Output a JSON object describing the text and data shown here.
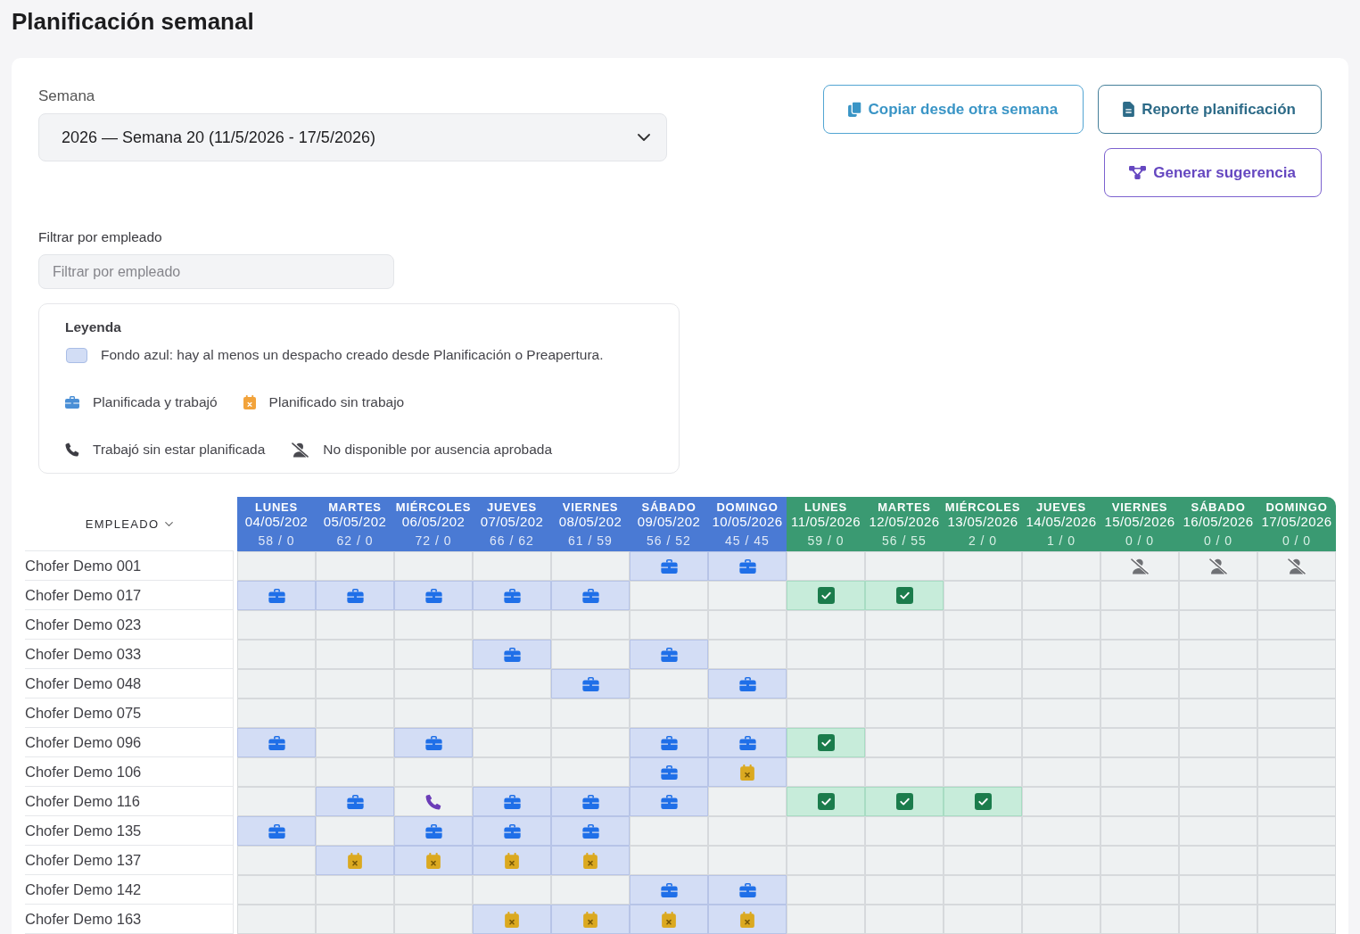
{
  "title": "Planificación semanal",
  "week_select": {
    "label": "Semana",
    "value": "2026 — Semana 20 (11/5/2026 - 17/5/2026)"
  },
  "actions": [
    {
      "kind": "copy",
      "label": "Copiar desde otra semana"
    },
    {
      "kind": "report",
      "label": "Reporte planificación"
    },
    {
      "kind": "suggest",
      "label": "Generar sugerencia"
    }
  ],
  "employee_filter": {
    "label": "Filtrar por empleado",
    "placeholder": "Filtrar por empleado"
  },
  "legend": {
    "title": "Leyenda",
    "rows": [
      [
        {
          "kind": "dispatch",
          "text": "Fondo azul: hay al menos un despacho creado desde Planificación o Preapertura."
        }
      ],
      [
        {
          "kind": "worked",
          "text": "Planificada y trabajó"
        },
        {
          "kind": "planned_no_work",
          "text": "Planificado sin trabajo"
        }
      ],
      [
        {
          "kind": "worked_unplanned",
          "text": "Trabajó sin estar planificada"
        },
        {
          "kind": "absent",
          "text": "No disponible por ausencia aprobada"
        }
      ]
    ]
  },
  "schedule": {
    "employee_column": "EMPLEADO",
    "weeks": [
      {
        "current": false,
        "days": [
          {
            "day": "LUNES",
            "date": "04/05/202",
            "counts": "58 / 0"
          },
          {
            "day": "MARTES",
            "date": "05/05/202",
            "counts": "62 / 0"
          },
          {
            "day": "MIÉRCOLES",
            "date": "06/05/202",
            "counts": "72 / 0"
          },
          {
            "day": "JUEVES",
            "date": "07/05/202",
            "counts": "66 / 62"
          },
          {
            "day": "VIERNES",
            "date": "08/05/202",
            "counts": "61 / 59"
          },
          {
            "day": "SÁBADO",
            "date": "09/05/202",
            "counts": "56 / 52"
          },
          {
            "day": "DOMINGO",
            "date": "10/05/2026",
            "counts": "45 / 45"
          }
        ]
      },
      {
        "current": true,
        "days": [
          {
            "day": "LUNES",
            "date": "11/05/2026",
            "counts": "59 / 0"
          },
          {
            "day": "MARTES",
            "date": "12/05/2026",
            "counts": "56 / 55"
          },
          {
            "day": "MIÉRCOLES",
            "date": "13/05/2026",
            "counts": "2 / 0"
          },
          {
            "day": "JUEVES",
            "date": "14/05/2026",
            "counts": "1 / 0"
          },
          {
            "day": "VIERNES",
            "date": "15/05/2026",
            "counts": "0 / 0"
          },
          {
            "day": "SÁBADO",
            "date": "16/05/2026",
            "counts": "0 / 0"
          },
          {
            "day": "DOMINGO",
            "date": "17/05/2026",
            "counts": "0 / 0"
          }
        ]
      }
    ],
    "rows": [
      {
        "employee": "Chofer Demo 001",
        "cells": [
          {
            "kind": "empty",
            "dispatch": false
          },
          {
            "kind": "empty",
            "dispatch": false
          },
          {
            "kind": "empty",
            "dispatch": false
          },
          {
            "kind": "empty",
            "dispatch": false
          },
          {
            "kind": "empty",
            "dispatch": false
          },
          {
            "kind": "worked",
            "dispatch": true
          },
          {
            "kind": "worked",
            "dispatch": true
          },
          {
            "kind": "empty",
            "dispatch": false
          },
          {
            "kind": "empty",
            "dispatch": false
          },
          {
            "kind": "empty",
            "dispatch": false
          },
          {
            "kind": "empty",
            "dispatch": false
          },
          {
            "kind": "absent",
            "dispatch": false
          },
          {
            "kind": "absent",
            "dispatch": false
          },
          {
            "kind": "absent",
            "dispatch": false
          }
        ]
      },
      {
        "employee": "Chofer Demo 017",
        "cells": [
          {
            "kind": "worked",
            "dispatch": true
          },
          {
            "kind": "worked",
            "dispatch": true
          },
          {
            "kind": "worked",
            "dispatch": true
          },
          {
            "kind": "worked",
            "dispatch": true
          },
          {
            "kind": "worked",
            "dispatch": true
          },
          {
            "kind": "empty",
            "dispatch": false
          },
          {
            "kind": "empty",
            "dispatch": false
          },
          {
            "kind": "confirmed",
            "dispatch": false
          },
          {
            "kind": "confirmed",
            "dispatch": false
          },
          {
            "kind": "empty",
            "dispatch": false
          },
          {
            "kind": "empty",
            "dispatch": false
          },
          {
            "kind": "empty",
            "dispatch": false
          },
          {
            "kind": "empty",
            "dispatch": false
          },
          {
            "kind": "empty",
            "dispatch": false
          }
        ]
      },
      {
        "employee": "Chofer Demo 023",
        "cells": [
          {
            "kind": "empty",
            "dispatch": false
          },
          {
            "kind": "empty",
            "dispatch": false
          },
          {
            "kind": "empty",
            "dispatch": false
          },
          {
            "kind": "empty",
            "dispatch": false
          },
          {
            "kind": "empty",
            "dispatch": false
          },
          {
            "kind": "empty",
            "dispatch": false
          },
          {
            "kind": "empty",
            "dispatch": false
          },
          {
            "kind": "empty",
            "dispatch": false
          },
          {
            "kind": "empty",
            "dispatch": false
          },
          {
            "kind": "empty",
            "dispatch": false
          },
          {
            "kind": "empty",
            "dispatch": false
          },
          {
            "kind": "empty",
            "dispatch": false
          },
          {
            "kind": "empty",
            "dispatch": false
          },
          {
            "kind": "empty",
            "dispatch": false
          }
        ]
      },
      {
        "employee": "Chofer Demo 033",
        "cells": [
          {
            "kind": "empty",
            "dispatch": false
          },
          {
            "kind": "empty",
            "dispatch": false
          },
          {
            "kind": "empty",
            "dispatch": false
          },
          {
            "kind": "worked",
            "dispatch": true
          },
          {
            "kind": "empty",
            "dispatch": false
          },
          {
            "kind": "worked",
            "dispatch": true
          },
          {
            "kind": "empty",
            "dispatch": false
          },
          {
            "kind": "empty",
            "dispatch": false
          },
          {
            "kind": "empty",
            "dispatch": false
          },
          {
            "kind": "empty",
            "dispatch": false
          },
          {
            "kind": "empty",
            "dispatch": false
          },
          {
            "kind": "empty",
            "dispatch": false
          },
          {
            "kind": "empty",
            "dispatch": false
          },
          {
            "kind": "empty",
            "dispatch": false
          }
        ]
      },
      {
        "employee": "Chofer Demo 048",
        "cells": [
          {
            "kind": "empty",
            "dispatch": false
          },
          {
            "kind": "empty",
            "dispatch": false
          },
          {
            "kind": "empty",
            "dispatch": false
          },
          {
            "kind": "empty",
            "dispatch": false
          },
          {
            "kind": "worked",
            "dispatch": true
          },
          {
            "kind": "empty",
            "dispatch": false
          },
          {
            "kind": "worked",
            "dispatch": true
          },
          {
            "kind": "empty",
            "dispatch": false
          },
          {
            "kind": "empty",
            "dispatch": false
          },
          {
            "kind": "empty",
            "dispatch": false
          },
          {
            "kind": "empty",
            "dispatch": false
          },
          {
            "kind": "empty",
            "dispatch": false
          },
          {
            "kind": "empty",
            "dispatch": false
          },
          {
            "kind": "empty",
            "dispatch": false
          }
        ]
      },
      {
        "employee": "Chofer Demo 075",
        "cells": [
          {
            "kind": "empty",
            "dispatch": false
          },
          {
            "kind": "empty",
            "dispatch": false
          },
          {
            "kind": "empty",
            "dispatch": false
          },
          {
            "kind": "empty",
            "dispatch": false
          },
          {
            "kind": "empty",
            "dispatch": false
          },
          {
            "kind": "empty",
            "dispatch": false
          },
          {
            "kind": "empty",
            "dispatch": false
          },
          {
            "kind": "empty",
            "dispatch": false
          },
          {
            "kind": "empty",
            "dispatch": false
          },
          {
            "kind": "empty",
            "dispatch": false
          },
          {
            "kind": "empty",
            "dispatch": false
          },
          {
            "kind": "empty",
            "dispatch": false
          },
          {
            "kind": "empty",
            "dispatch": false
          },
          {
            "kind": "empty",
            "dispatch": false
          }
        ]
      },
      {
        "employee": "Chofer Demo 096",
        "cells": [
          {
            "kind": "worked",
            "dispatch": true
          },
          {
            "kind": "empty",
            "dispatch": false
          },
          {
            "kind": "worked",
            "dispatch": true
          },
          {
            "kind": "empty",
            "dispatch": false
          },
          {
            "kind": "empty",
            "dispatch": false
          },
          {
            "kind": "worked",
            "dispatch": true
          },
          {
            "kind": "worked",
            "dispatch": true
          },
          {
            "kind": "confirmed",
            "dispatch": false
          },
          {
            "kind": "empty",
            "dispatch": false
          },
          {
            "kind": "empty",
            "dispatch": false
          },
          {
            "kind": "empty",
            "dispatch": false
          },
          {
            "kind": "empty",
            "dispatch": false
          },
          {
            "kind": "empty",
            "dispatch": false
          },
          {
            "kind": "empty",
            "dispatch": false
          }
        ]
      },
      {
        "employee": "Chofer Demo 106",
        "cells": [
          {
            "kind": "empty",
            "dispatch": false
          },
          {
            "kind": "empty",
            "dispatch": false
          },
          {
            "kind": "empty",
            "dispatch": false
          },
          {
            "kind": "empty",
            "dispatch": false
          },
          {
            "kind": "empty",
            "dispatch": false
          },
          {
            "kind": "worked",
            "dispatch": true
          },
          {
            "kind": "planned_no_work",
            "dispatch": true
          },
          {
            "kind": "empty",
            "dispatch": false
          },
          {
            "kind": "empty",
            "dispatch": false
          },
          {
            "kind": "empty",
            "dispatch": false
          },
          {
            "kind": "empty",
            "dispatch": false
          },
          {
            "kind": "empty",
            "dispatch": false
          },
          {
            "kind": "empty",
            "dispatch": false
          },
          {
            "kind": "empty",
            "dispatch": false
          }
        ]
      },
      {
        "employee": "Chofer Demo 116",
        "cells": [
          {
            "kind": "empty",
            "dispatch": false
          },
          {
            "kind": "worked",
            "dispatch": true
          },
          {
            "kind": "worked_unplanned",
            "dispatch": false
          },
          {
            "kind": "worked",
            "dispatch": true
          },
          {
            "kind": "worked",
            "dispatch": true
          },
          {
            "kind": "worked",
            "dispatch": true
          },
          {
            "kind": "empty",
            "dispatch": false
          },
          {
            "kind": "confirmed",
            "dispatch": false
          },
          {
            "kind": "confirmed",
            "dispatch": false
          },
          {
            "kind": "confirmed",
            "dispatch": false
          },
          {
            "kind": "empty",
            "dispatch": false
          },
          {
            "kind": "empty",
            "dispatch": false
          },
          {
            "kind": "empty",
            "dispatch": false
          },
          {
            "kind": "empty",
            "dispatch": false
          }
        ]
      },
      {
        "employee": "Chofer Demo 135",
        "cells": [
          {
            "kind": "worked",
            "dispatch": true
          },
          {
            "kind": "empty",
            "dispatch": false
          },
          {
            "kind": "worked",
            "dispatch": true
          },
          {
            "kind": "worked",
            "dispatch": true
          },
          {
            "kind": "worked",
            "dispatch": true
          },
          {
            "kind": "empty",
            "dispatch": false
          },
          {
            "kind": "empty",
            "dispatch": false
          },
          {
            "kind": "empty",
            "dispatch": false
          },
          {
            "kind": "empty",
            "dispatch": false
          },
          {
            "kind": "empty",
            "dispatch": false
          },
          {
            "kind": "empty",
            "dispatch": false
          },
          {
            "kind": "empty",
            "dispatch": false
          },
          {
            "kind": "empty",
            "dispatch": false
          },
          {
            "kind": "empty",
            "dispatch": false
          }
        ]
      },
      {
        "employee": "Chofer Demo 137",
        "cells": [
          {
            "kind": "empty",
            "dispatch": false
          },
          {
            "kind": "planned_no_work",
            "dispatch": true
          },
          {
            "kind": "planned_no_work",
            "dispatch": true
          },
          {
            "kind": "planned_no_work",
            "dispatch": true
          },
          {
            "kind": "planned_no_work",
            "dispatch": true
          },
          {
            "kind": "empty",
            "dispatch": false
          },
          {
            "kind": "empty",
            "dispatch": false
          },
          {
            "kind": "empty",
            "dispatch": false
          },
          {
            "kind": "empty",
            "dispatch": false
          },
          {
            "kind": "empty",
            "dispatch": false
          },
          {
            "kind": "empty",
            "dispatch": false
          },
          {
            "kind": "empty",
            "dispatch": false
          },
          {
            "kind": "empty",
            "dispatch": false
          },
          {
            "kind": "empty",
            "dispatch": false
          }
        ]
      },
      {
        "employee": "Chofer Demo 142",
        "cells": [
          {
            "kind": "empty",
            "dispatch": false
          },
          {
            "kind": "empty",
            "dispatch": false
          },
          {
            "kind": "empty",
            "dispatch": false
          },
          {
            "kind": "empty",
            "dispatch": false
          },
          {
            "kind": "empty",
            "dispatch": false
          },
          {
            "kind": "worked",
            "dispatch": true
          },
          {
            "kind": "worked",
            "dispatch": true
          },
          {
            "kind": "empty",
            "dispatch": false
          },
          {
            "kind": "empty",
            "dispatch": false
          },
          {
            "kind": "empty",
            "dispatch": false
          },
          {
            "kind": "empty",
            "dispatch": false
          },
          {
            "kind": "empty",
            "dispatch": false
          },
          {
            "kind": "empty",
            "dispatch": false
          },
          {
            "kind": "empty",
            "dispatch": false
          }
        ]
      },
      {
        "employee": "Chofer Demo 163",
        "cells": [
          {
            "kind": "empty",
            "dispatch": false
          },
          {
            "kind": "empty",
            "dispatch": false
          },
          {
            "kind": "empty",
            "dispatch": false
          },
          {
            "kind": "planned_no_work",
            "dispatch": true
          },
          {
            "kind": "planned_no_work",
            "dispatch": true
          },
          {
            "kind": "planned_no_work",
            "dispatch": true
          },
          {
            "kind": "planned_no_work",
            "dispatch": true
          },
          {
            "kind": "empty",
            "dispatch": false
          },
          {
            "kind": "empty",
            "dispatch": false
          },
          {
            "kind": "empty",
            "dispatch": false
          },
          {
            "kind": "empty",
            "dispatch": false
          },
          {
            "kind": "empty",
            "dispatch": false
          },
          {
            "kind": "empty",
            "dispatch": false
          },
          {
            "kind": "empty",
            "dispatch": false
          }
        ]
      }
    ]
  }
}
